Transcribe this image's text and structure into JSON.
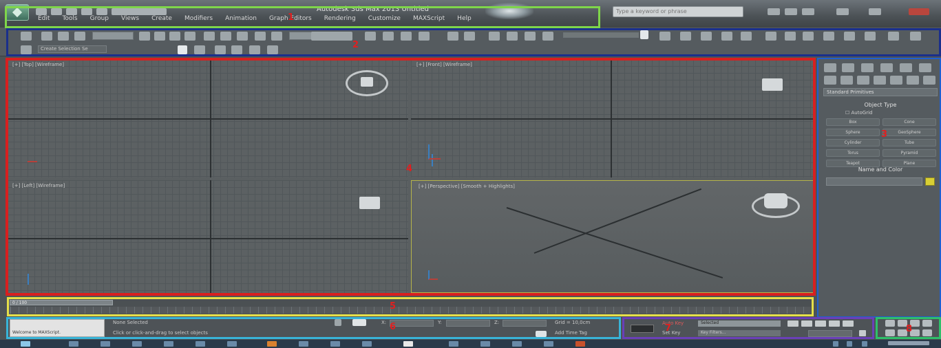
{
  "titlebar": {
    "title": "Autodesk 3ds Max 2013   Untitled",
    "search_placeholder": "Type a keyword or phrase",
    "menu": [
      "Edit",
      "Tools",
      "Group",
      "Views",
      "Create",
      "Modifiers",
      "Animation",
      "Graph Editors",
      "Rendering",
      "Customize",
      "MAXScript",
      "Help"
    ]
  },
  "toolbar": {
    "selection_filter": "All",
    "view_dropdown": "View",
    "named_selection": "Create Selection Se"
  },
  "viewports": {
    "top": "[+] [Top] [Wireframe]",
    "front": "[+] [Front] [Wireframe]",
    "left": "[+] [Left] [Wireframe]",
    "perspective": "[+] [Perspective] [Smooth + Highlights]"
  },
  "command_panel": {
    "category": "Standard Primitives",
    "object_type": "Object Type",
    "autogrid": "AutoGrid",
    "buttons": [
      [
        "Box",
        "Cone"
      ],
      [
        "Sphere",
        "GeoSphere"
      ],
      [
        "Cylinder",
        "Tube"
      ],
      [
        "Torus",
        "Pyramid"
      ],
      [
        "Teapot",
        "Plane"
      ]
    ],
    "name_and_color": "Name and Color"
  },
  "timeslider": {
    "frame": "0 / 100"
  },
  "statusbar": {
    "maxscript": "Welcome to MAXScript.",
    "selection": "None Selected",
    "prompt": "Click or click-and-drag to select objects",
    "x_label": "X:",
    "y_label": "Y:",
    "z_label": "Z:",
    "grid": "Grid = 10,0cm",
    "add_time_tag": "Add Time Tag"
  },
  "animation": {
    "auto_key": "Auto Key",
    "set_key": "Set Key",
    "selected": "Selected",
    "key_filters": "Key Filters..."
  },
  "annotations": [
    "1",
    "2",
    "3",
    "4",
    "5",
    "6",
    "7",
    "8",
    "9"
  ],
  "colors": {
    "box1": "#7fd64a",
    "box2": "#1a2f8c",
    "box3": "#1f5fd0",
    "box4": "#d81f1f",
    "box5": "#e6e04a",
    "box6": "#38b4d8",
    "box7": "#6a3fb8",
    "box8": "#2fbf6a",
    "number": "#e02020"
  }
}
